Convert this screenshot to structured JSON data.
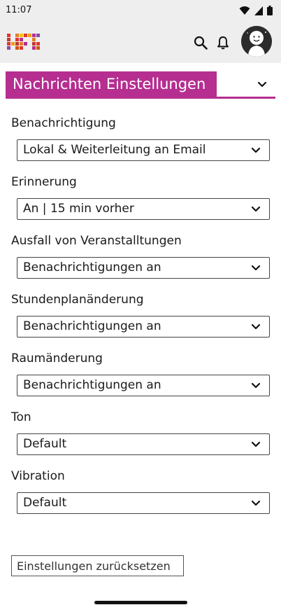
{
  "status_bar": {
    "time": "11:07",
    "icons": [
      "wifi-icon",
      "signal-icon",
      "battery-icon"
    ]
  },
  "app_bar": {
    "logo": "hfs-logo",
    "icons": [
      "search-icon",
      "bell-icon",
      "avatar"
    ]
  },
  "section": {
    "title": "Nachrichten Einstellungen",
    "accent_color": "#b52e90"
  },
  "fields": [
    {
      "label": "Benachrichtigung",
      "value": "Lokal & Weiterleitung an Email"
    },
    {
      "label": "Erinnerung",
      "value": "An | 15 min vorher"
    },
    {
      "label": "Ausfall von Veranstalltungen",
      "value": "Benachrichtigungen an"
    },
    {
      "label": "Stundenplanänderung",
      "value": "Benachrichtigungen an"
    },
    {
      "label": "Raumänderung",
      "value": "Benachrichtigungen an"
    },
    {
      "label": "Ton",
      "value": "Default"
    },
    {
      "label": "Vibration",
      "value": "Default"
    }
  ],
  "reset_button": {
    "label": "Einstellungen zurücksetzen"
  }
}
